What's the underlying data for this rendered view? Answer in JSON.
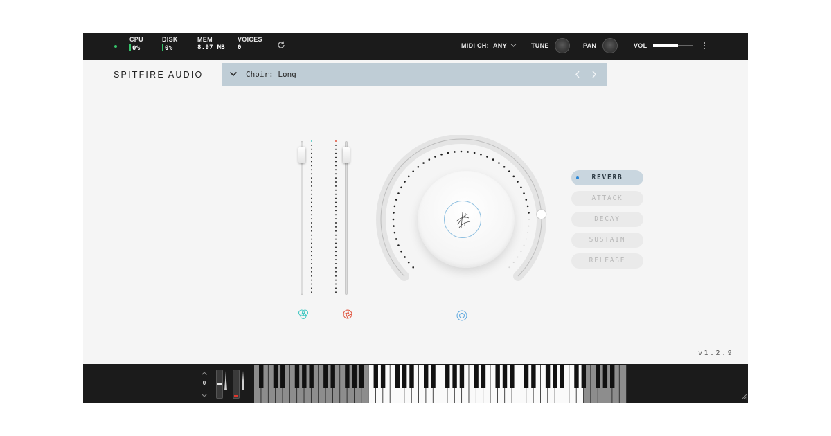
{
  "topbar": {
    "cpu": {
      "label": "CPU",
      "value": "0%"
    },
    "disk": {
      "label": "DISK",
      "value": "0%"
    },
    "mem": {
      "label": "MEM",
      "value": "8.97 MB"
    },
    "voices": {
      "label": "VOICES",
      "value": "0"
    },
    "midi_label": "MIDI CH:",
    "midi_value": "ANY",
    "tune_label": "TUNE",
    "pan_label": "PAN",
    "vol_label": "VOL",
    "vol_level": 0.62
  },
  "header": {
    "brand": "SPITFIRE AUDIO",
    "preset": "Choir: Long"
  },
  "faders": {
    "expression": {
      "icon": "expression-icon",
      "color": "#3cc6c0",
      "level": 0.96
    },
    "dynamics": {
      "icon": "dynamics-icon",
      "color": "#e0543e",
      "level": 0.96
    }
  },
  "dial": {
    "icon": "spitfire-logo-icon",
    "level": 0.82
  },
  "envelope": {
    "buttons": [
      {
        "label": "REVERB",
        "active": true
      },
      {
        "label": "ATTACK",
        "active": false
      },
      {
        "label": "DECAY",
        "active": false
      },
      {
        "label": "SUSTAIN",
        "active": false
      },
      {
        "label": "RELEASE",
        "active": false
      }
    ]
  },
  "version": "v1.2.9",
  "keyboard": {
    "octave": "0",
    "active_range": "C2–C7 (white keys)",
    "colors": {
      "accent_blue": "#2a86d8",
      "meter_green": "#35c46a"
    }
  }
}
